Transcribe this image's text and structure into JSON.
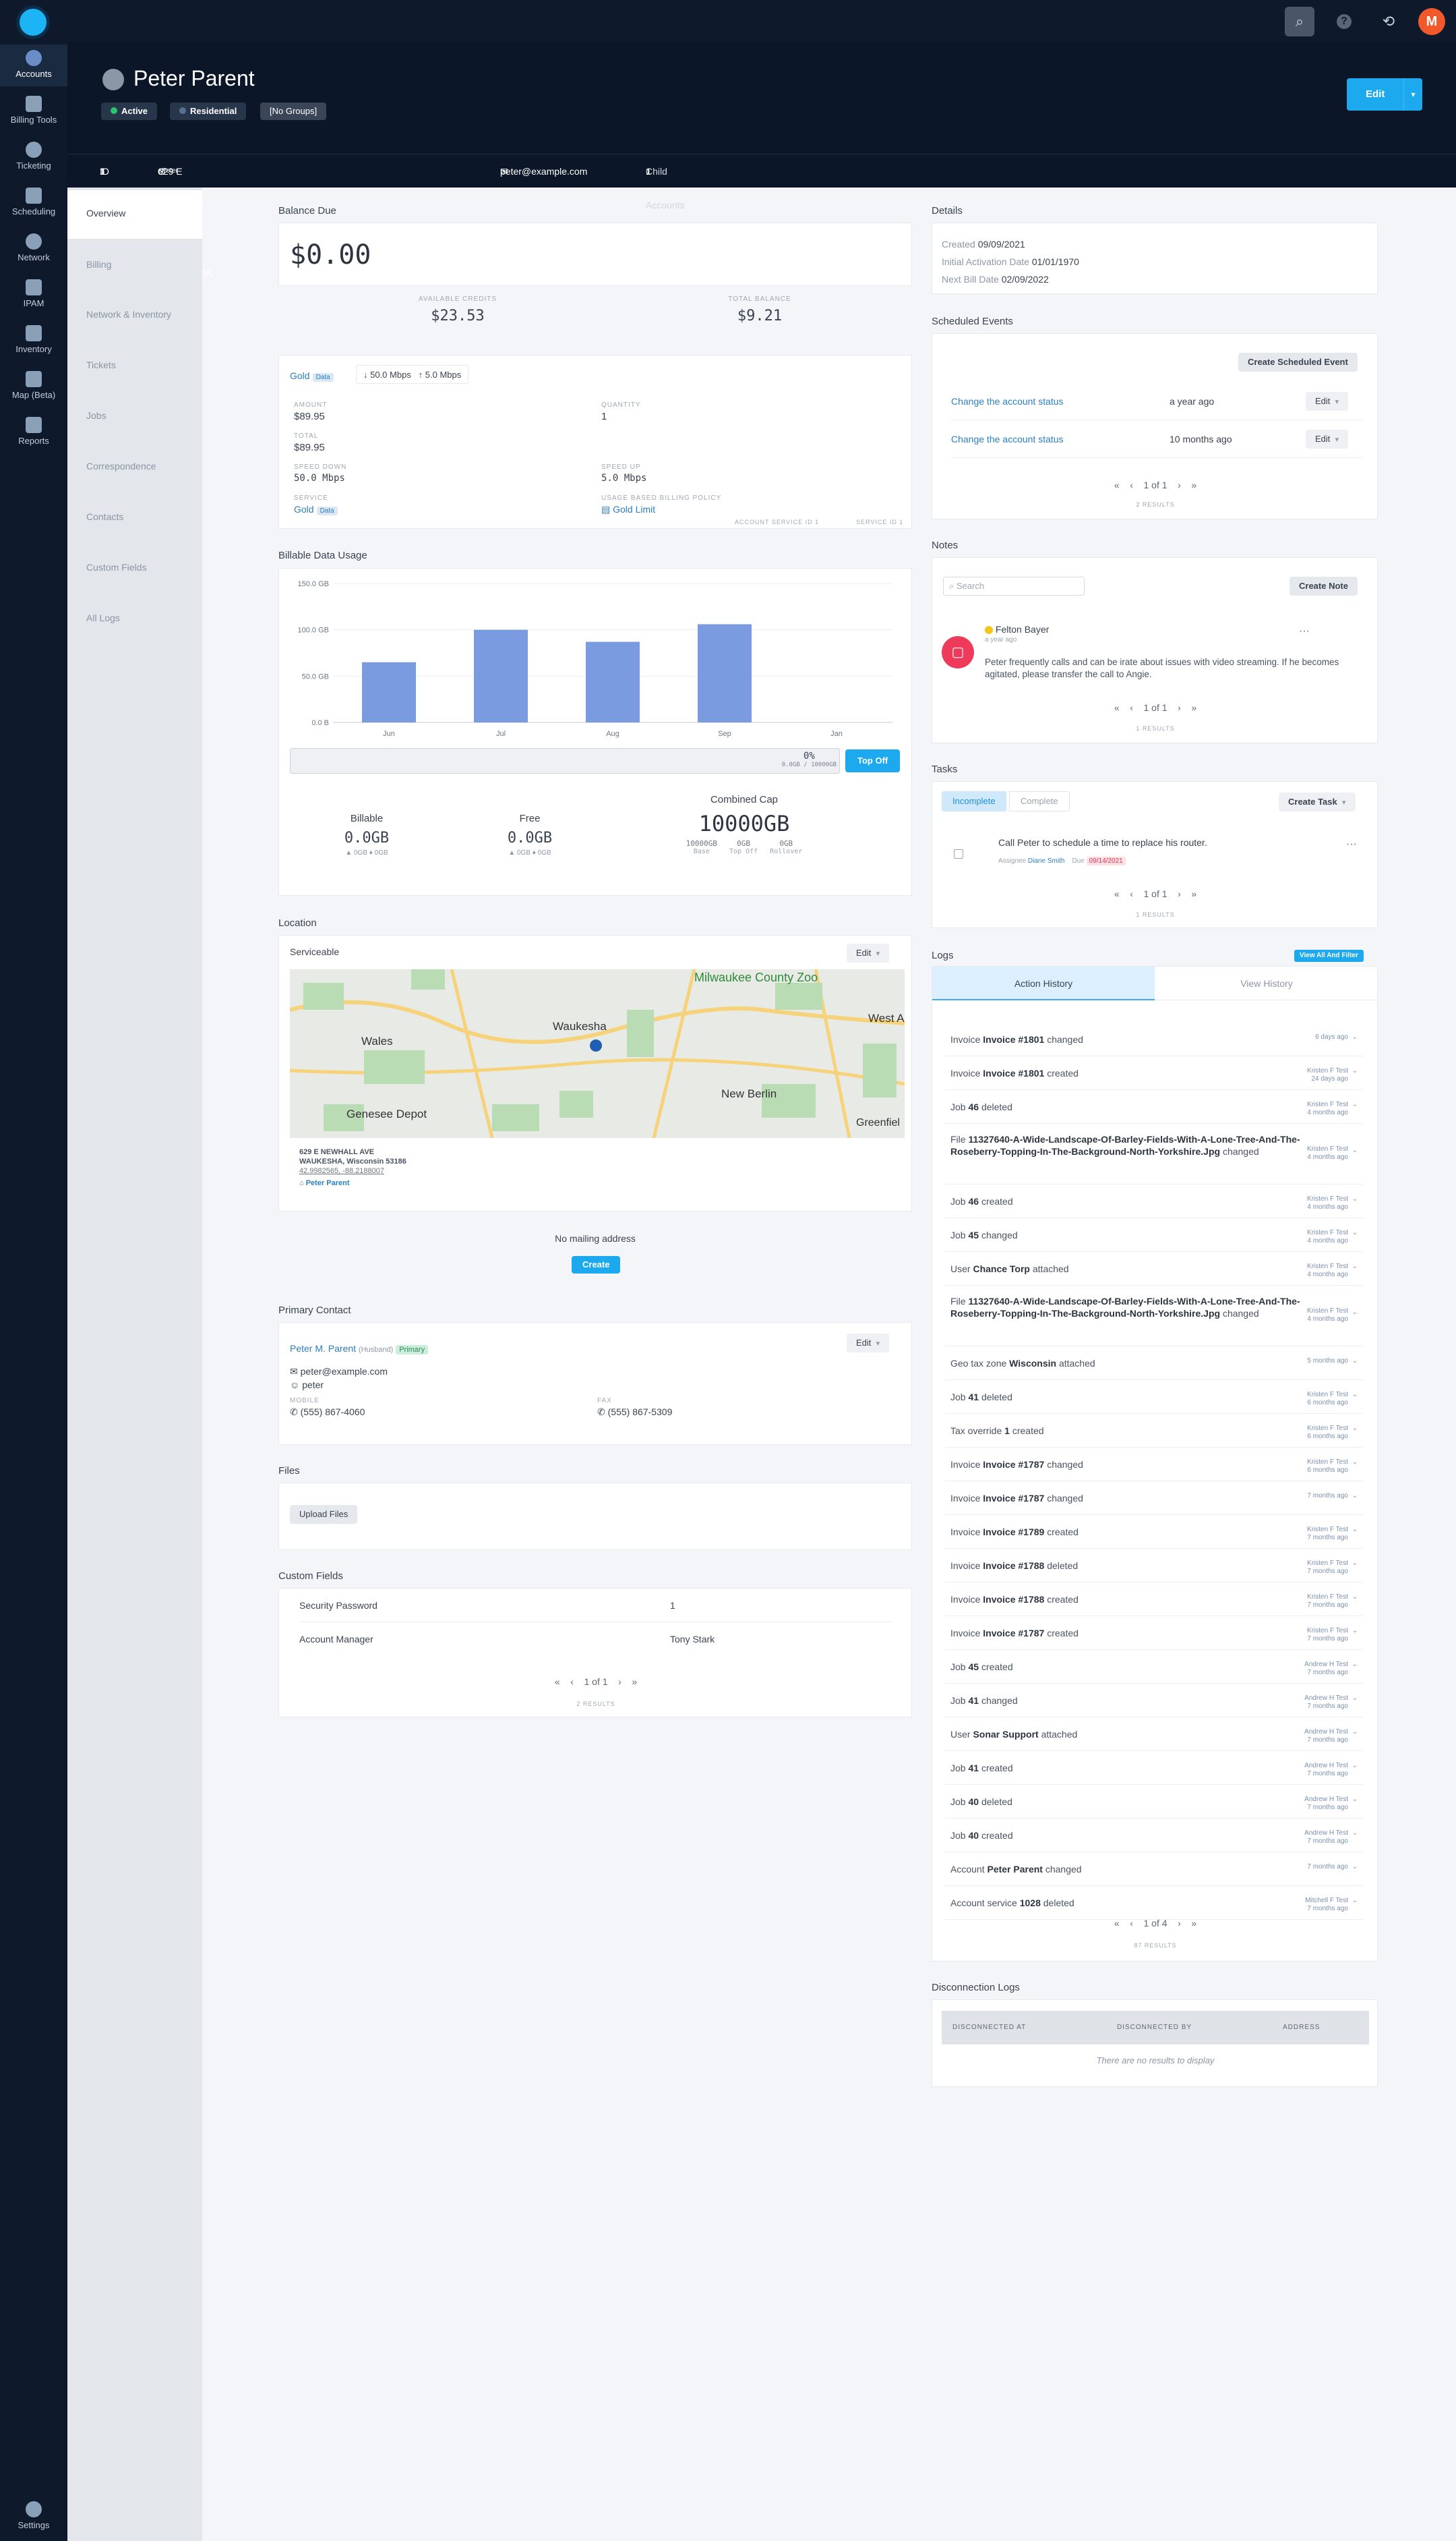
{
  "nav": {
    "items": [
      {
        "label": "Accounts",
        "icon": "user-icon"
      },
      {
        "label": "Billing Tools",
        "icon": "calculator-icon"
      },
      {
        "label": "Ticketing",
        "icon": "chat-icon"
      },
      {
        "label": "Scheduling",
        "icon": "calendar-icon"
      },
      {
        "label": "Network",
        "icon": "network-icon"
      },
      {
        "label": "IPAM",
        "icon": "ipam-icon"
      },
      {
        "label": "Inventory",
        "icon": "cart-icon"
      },
      {
        "label": "Map (Beta)",
        "icon": "map-icon"
      },
      {
        "label": "Reports",
        "icon": "report-icon"
      }
    ],
    "settings_label": "Settings"
  },
  "topbar": {
    "search_icon": "⌕",
    "help_icon": "?",
    "history_icon": "⟲",
    "user_initial": "M"
  },
  "header": {
    "name": "Peter Parent",
    "badges": [
      "Active",
      "Residential",
      "[No Groups]"
    ],
    "edit_label": "Edit",
    "id_label": "ID",
    "id_value": "1",
    "address": "629 E NEWHALL AVE, WAUKESHA, Wisconsin 53186",
    "address_owner": "Peter Parent",
    "email": "peter@example.com",
    "child_label": "Child Accounts",
    "child_value": "1"
  },
  "leftnav": [
    "Overview",
    "Billing",
    "Network & Inventory",
    "Tickets",
    "Jobs",
    "Correspondence",
    "Contacts",
    "Custom Fields",
    "All Logs"
  ],
  "balance": {
    "title": "Balance Due",
    "amount": "$0.00",
    "credits_label": "AVAILABLE CREDITS",
    "credits": "$23.53",
    "total_label": "TOTAL BALANCE",
    "total": "$9.21"
  },
  "service": {
    "name": "Gold",
    "tag": "Data",
    "down": "↓ 50.0 Mbps",
    "up": "↑ 5.0 Mbps",
    "amount_label": "AMOUNT",
    "amount": "$89.95",
    "qty_label": "QUANTITY",
    "qty": "1",
    "total_label": "TOTAL",
    "total": "$89.95",
    "speed_down_label": "SPEED DOWN",
    "speed_down": "50.0 Mbps",
    "speed_up_label": "SPEED UP",
    "speed_up": "5.0 Mbps",
    "service_label": "SERVICE",
    "service_name": "Gold",
    "service_tag": "Data",
    "policy_label": "USAGE BASED BILLING POLICY",
    "policy": "Gold Limit",
    "acct_service_id": "ACCOUNT SERVICE ID 1",
    "service_id": "SERVICE ID 1"
  },
  "usage": {
    "title": "Billable Data Usage",
    "percent": "0%",
    "percent_sub": "0.0GB / 10000GB",
    "topoff_label": "Top Off",
    "billable_label": "Billable",
    "billable_value": "0.0GB",
    "billable_sub": "▲ 0GB  ♦ 0GB",
    "free_label": "Free",
    "free_value": "0.0GB",
    "free_sub": "▲ 0GB  ♦ 0GB",
    "cap_label": "Combined Cap",
    "cap_value": "10000GB",
    "cap_parts": [
      {
        "v": "10000GB",
        "l": "Base"
      },
      {
        "v": "0GB",
        "l": "Top Off"
      },
      {
        "v": "0GB",
        "l": "Rollover"
      }
    ]
  },
  "chart_data": {
    "type": "bar",
    "categories": [
      "Jun",
      "Jul",
      "Aug",
      "Sep",
      "Jan"
    ],
    "values": [
      65,
      100,
      87,
      106,
      0
    ],
    "yticks": [
      "150.0 GB",
      "100.0 GB",
      "50.0 GB",
      "0.0 B"
    ],
    "ylim": [
      0,
      150
    ],
    "color": "#7b9be0"
  },
  "location": {
    "title": "Location",
    "status": "Serviceable",
    "edit_label": "Edit",
    "addr1": "629 E NEWHALL AVE",
    "addr2": "WAUKESHA, Wisconsin 53186",
    "coords": "42.9982565, -88.2188007",
    "owner": "Peter Parent",
    "map_labels": [
      "Milwaukee County Zoo",
      "Waukesha",
      "Wales",
      "West A",
      "Genesee Depot",
      "New Berlin",
      "Greenfiel"
    ],
    "no_mailing": "No mailing address",
    "create_label": "Create"
  },
  "contact": {
    "title": "Primary Contact",
    "name": "Peter M. Parent",
    "relation": "(Husband)",
    "primary": "Primary",
    "edit_label": "Edit",
    "email": "peter@example.com",
    "username": "peter",
    "mobile_label": "MOBILE",
    "mobile": "(555) 867-4060",
    "fax_label": "FAX",
    "fax": "(555) 867-5309"
  },
  "files": {
    "title": "Files",
    "upload_label": "Upload Files"
  },
  "custom": {
    "title": "Custom Fields",
    "rows": [
      {
        "k": "Security Password",
        "v": "1"
      },
      {
        "k": "Account Manager",
        "v": "Tony Stark"
      }
    ],
    "pager": "1 of 1",
    "results": "2 RESULTS"
  },
  "details": {
    "title": "Details",
    "created_label": "Created",
    "created": "09/09/2021",
    "activation_label": "Initial Activation Date",
    "activation": "01/01/1970",
    "bill_label": "Next Bill Date",
    "bill": "02/09/2022"
  },
  "scheduled": {
    "title": "Scheduled Events",
    "create_label": "Create Scheduled Event",
    "rows": [
      {
        "t": "Change the account status",
        "w": "a year ago"
      },
      {
        "t": "Change the account status",
        "w": "10 months ago"
      }
    ],
    "edit_label": "Edit",
    "pager": "1 of 1",
    "results": "2 RESULTS"
  },
  "notes": {
    "title": "Notes",
    "search_placeholder": "Search",
    "create_label": "Create Note",
    "author": "Felton Bayer",
    "when": "a year ago",
    "body": "Peter frequently calls and can be irate about issues with video streaming. If he becomes agitated, please transfer the call to Angie.",
    "pager": "1 of 1",
    "results": "1 RESULTS"
  },
  "tasks": {
    "title": "Tasks",
    "tabs": [
      "Incomplete",
      "Complete"
    ],
    "create_label": "Create Task",
    "task": "Call Peter to schedule a time to replace his router.",
    "assignee_label": "Assignee",
    "assignee": "Diane Smith",
    "due_label": "Due",
    "due": "09/14/2021",
    "pager": "1 of 1",
    "results": "1 RESULTS"
  },
  "logs": {
    "title": "Logs",
    "view_all_label": "View All And Filter",
    "tabs": [
      "Action History",
      "View History"
    ],
    "rows": [
      {
        "pre": "Invoice",
        "b": "Invoice #1801",
        "post": "changed",
        "m1": "6 days ago",
        "m2": ""
      },
      {
        "pre": "Invoice",
        "b": "Invoice #1801",
        "post": "created",
        "m1": "Kristen F Test",
        "m2": "24 days ago"
      },
      {
        "pre": "Job",
        "b": "46",
        "post": "deleted",
        "m1": "Kristen F Test",
        "m2": "4 months ago"
      },
      {
        "pre": "File",
        "b": "11327640-A-Wide-Landscape-Of-Barley-Fields-With-A-Lone-Tree-And-The-Roseberry-Topping-In-The-Background-North-Yorkshire.Jpg",
        "post": "changed",
        "m1": "Kristen F Test",
        "m2": "4 months ago"
      },
      {
        "pre": "Job",
        "b": "46",
        "post": "created",
        "m1": "Kristen F Test",
        "m2": "4 months ago"
      },
      {
        "pre": "Job",
        "b": "45",
        "post": "changed",
        "m1": "Kristen F Test",
        "m2": "4 months ago"
      },
      {
        "pre": "User",
        "b": "Chance Torp",
        "post": "attached",
        "m1": "Kristen F Test",
        "m2": "4 months ago"
      },
      {
        "pre": "File",
        "b": "11327640-A-Wide-Landscape-Of-Barley-Fields-With-A-Lone-Tree-And-The-Roseberry-Topping-In-The-Background-North-Yorkshire.Jpg",
        "post": "changed",
        "m1": "Kristen F Test",
        "m2": "4 months ago"
      },
      {
        "pre": "Geo tax zone",
        "b": "Wisconsin",
        "post": "attached",
        "m1": "5 months ago",
        "m2": ""
      },
      {
        "pre": "Job",
        "b": "41",
        "post": "deleted",
        "m1": "Kristen F Test",
        "m2": "6 months ago"
      },
      {
        "pre": "Tax override",
        "b": "1",
        "post": "created",
        "m1": "Kristen F Test",
        "m2": "6 months ago"
      },
      {
        "pre": "Invoice",
        "b": "Invoice #1787",
        "post": "changed",
        "m1": "Kristen F Test",
        "m2": "6 months ago"
      },
      {
        "pre": "Invoice",
        "b": "Invoice #1787",
        "post": "changed",
        "m1": "7 months ago",
        "m2": ""
      },
      {
        "pre": "Invoice",
        "b": "Invoice #1789",
        "post": "created",
        "m1": "Kristen F Test",
        "m2": "7 months ago"
      },
      {
        "pre": "Invoice",
        "b": "Invoice #1788",
        "post": "deleted",
        "m1": "Kristen F Test",
        "m2": "7 months ago"
      },
      {
        "pre": "Invoice",
        "b": "Invoice #1788",
        "post": "created",
        "m1": "Kristen F Test",
        "m2": "7 months ago"
      },
      {
        "pre": "Invoice",
        "b": "Invoice #1787",
        "post": "created",
        "m1": "Kristen F Test",
        "m2": "7 months ago"
      },
      {
        "pre": "Job",
        "b": "45",
        "post": "created",
        "m1": "Andrew H Test",
        "m2": "7 months ago"
      },
      {
        "pre": "Job",
        "b": "41",
        "post": "changed",
        "m1": "Andrew H Test",
        "m2": "7 months ago"
      },
      {
        "pre": "User",
        "b": "Sonar Support",
        "post": "attached",
        "m1": "Andrew H Test",
        "m2": "7 months ago"
      },
      {
        "pre": "Job",
        "b": "41",
        "post": "created",
        "m1": "Andrew H Test",
        "m2": "7 months ago"
      },
      {
        "pre": "Job",
        "b": "40",
        "post": "deleted",
        "m1": "Andrew H Test",
        "m2": "7 months ago"
      },
      {
        "pre": "Job",
        "b": "40",
        "post": "created",
        "m1": "Andrew H Test",
        "m2": "7 months ago"
      },
      {
        "pre": "Account",
        "b": "Peter Parent",
        "post": "changed",
        "m1": "7 months ago",
        "m2": ""
      },
      {
        "pre": "Account service",
        "b": "1028",
        "post": "deleted",
        "m1": "Mitchell F Test",
        "m2": "7 months ago"
      }
    ],
    "pager": "1 of 4",
    "results": "87 RESULTS"
  },
  "disconnection": {
    "title": "Disconnection Logs",
    "cols": [
      "DISCONNECTED AT",
      "DISCONNECTED BY",
      "ADDRESS"
    ],
    "empty": "There are no results to display"
  },
  "pager_glyphs": {
    "first": "«",
    "prev": "‹",
    "next": "›",
    "last": "»"
  }
}
